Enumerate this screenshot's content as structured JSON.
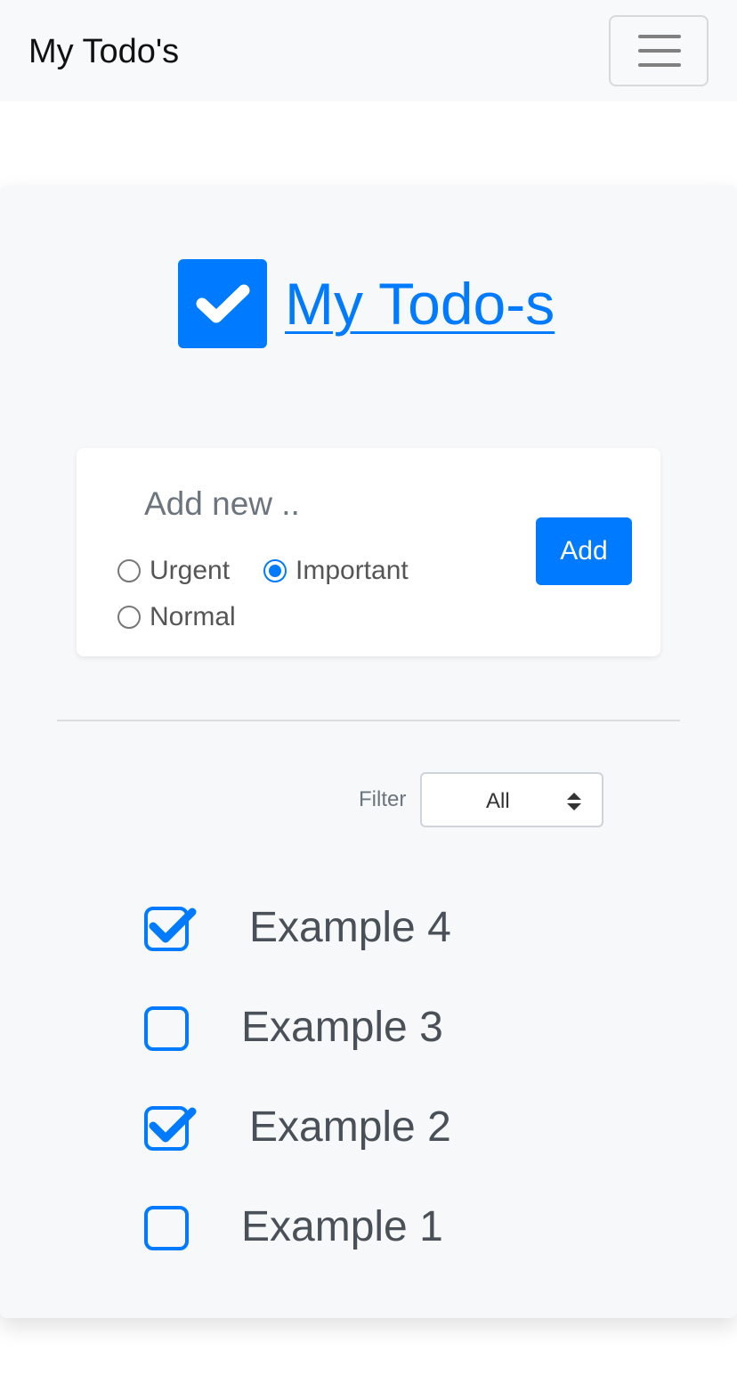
{
  "navbar": {
    "brand": "My Todo's",
    "toggler_icon": "hamburger-icon"
  },
  "header": {
    "logo_icon": "check-square-icon",
    "title": "My Todo-s"
  },
  "add_form": {
    "input_placeholder": "Add new ..",
    "input_value": "",
    "priorities": [
      {
        "label": "Urgent",
        "checked": false
      },
      {
        "label": "Important",
        "checked": true
      },
      {
        "label": "Normal",
        "checked": false
      }
    ],
    "add_button_label": "Add"
  },
  "filter": {
    "label": "Filter",
    "selected": "All",
    "arrows_icon": "sort-arrows-icon"
  },
  "todos": [
    {
      "label": "Example 4",
      "done": true
    },
    {
      "label": "Example 3",
      "done": false
    },
    {
      "label": "Example 2",
      "done": true
    },
    {
      "label": "Example 1",
      "done": false
    }
  ],
  "colors": {
    "accent": "#007bff",
    "text": "#495057",
    "navbar_bg": "#f8f9fa",
    "card_bg": "#f7f8fa"
  }
}
